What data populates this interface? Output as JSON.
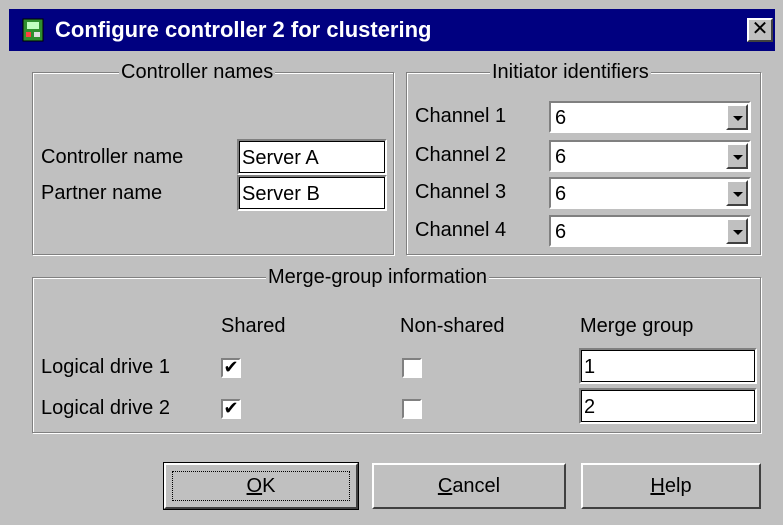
{
  "window": {
    "title": "Configure controller 2 for clustering",
    "icon": "controller-app-icon",
    "close_glyph": "✕"
  },
  "controller_names": {
    "legend": "Controller names",
    "controller_label": "Controller name",
    "controller_value": "Server A",
    "partner_label": "Partner name",
    "partner_value": "Server B"
  },
  "initiator": {
    "legend": "Initiator identifiers",
    "channels": [
      {
        "label": "Channel 1",
        "value": "6"
      },
      {
        "label": "Channel 2",
        "value": "6"
      },
      {
        "label": "Channel 3",
        "value": "6"
      },
      {
        "label": "Channel 4",
        "value": "6"
      }
    ]
  },
  "merge": {
    "legend": "Merge-group information",
    "col_shared": "Shared",
    "col_nonshared": "Non-shared",
    "col_group": "Merge group",
    "rows": [
      {
        "label": "Logical drive 1",
        "shared": true,
        "nonshared": false,
        "group": "1"
      },
      {
        "label": "Logical drive 2",
        "shared": true,
        "nonshared": false,
        "group": "2"
      }
    ]
  },
  "buttons": {
    "ok_accel": "O",
    "ok_rest": "K",
    "cancel_accel": "C",
    "cancel_rest": "ancel",
    "help_accel": "H",
    "help_rest": "elp"
  },
  "check_glyph": "✔"
}
